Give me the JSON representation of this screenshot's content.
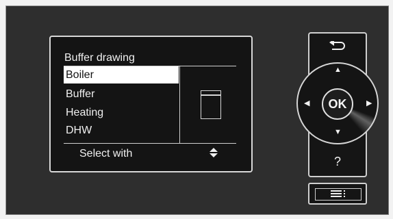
{
  "screen": {
    "title": "Buffer drawing",
    "menu_items": [
      {
        "label": "Boiler",
        "selected": true
      },
      {
        "label": "Buffer",
        "selected": false
      },
      {
        "label": "Heating",
        "selected": false
      },
      {
        "label": "DHW",
        "selected": false
      }
    ],
    "footer_text": "Select with",
    "preview_icon": "buffer-tank-icon",
    "footer_icon": "up-down-arrows-icon"
  },
  "controls": {
    "back_icon": "back-arrow-icon",
    "ok_label": "OK",
    "help_label": "?",
    "menu_icon": "menu-list-icon",
    "direction_icons": [
      "arrow-up-icon",
      "arrow-down-icon",
      "arrow-left-icon",
      "arrow-right-icon"
    ]
  }
}
